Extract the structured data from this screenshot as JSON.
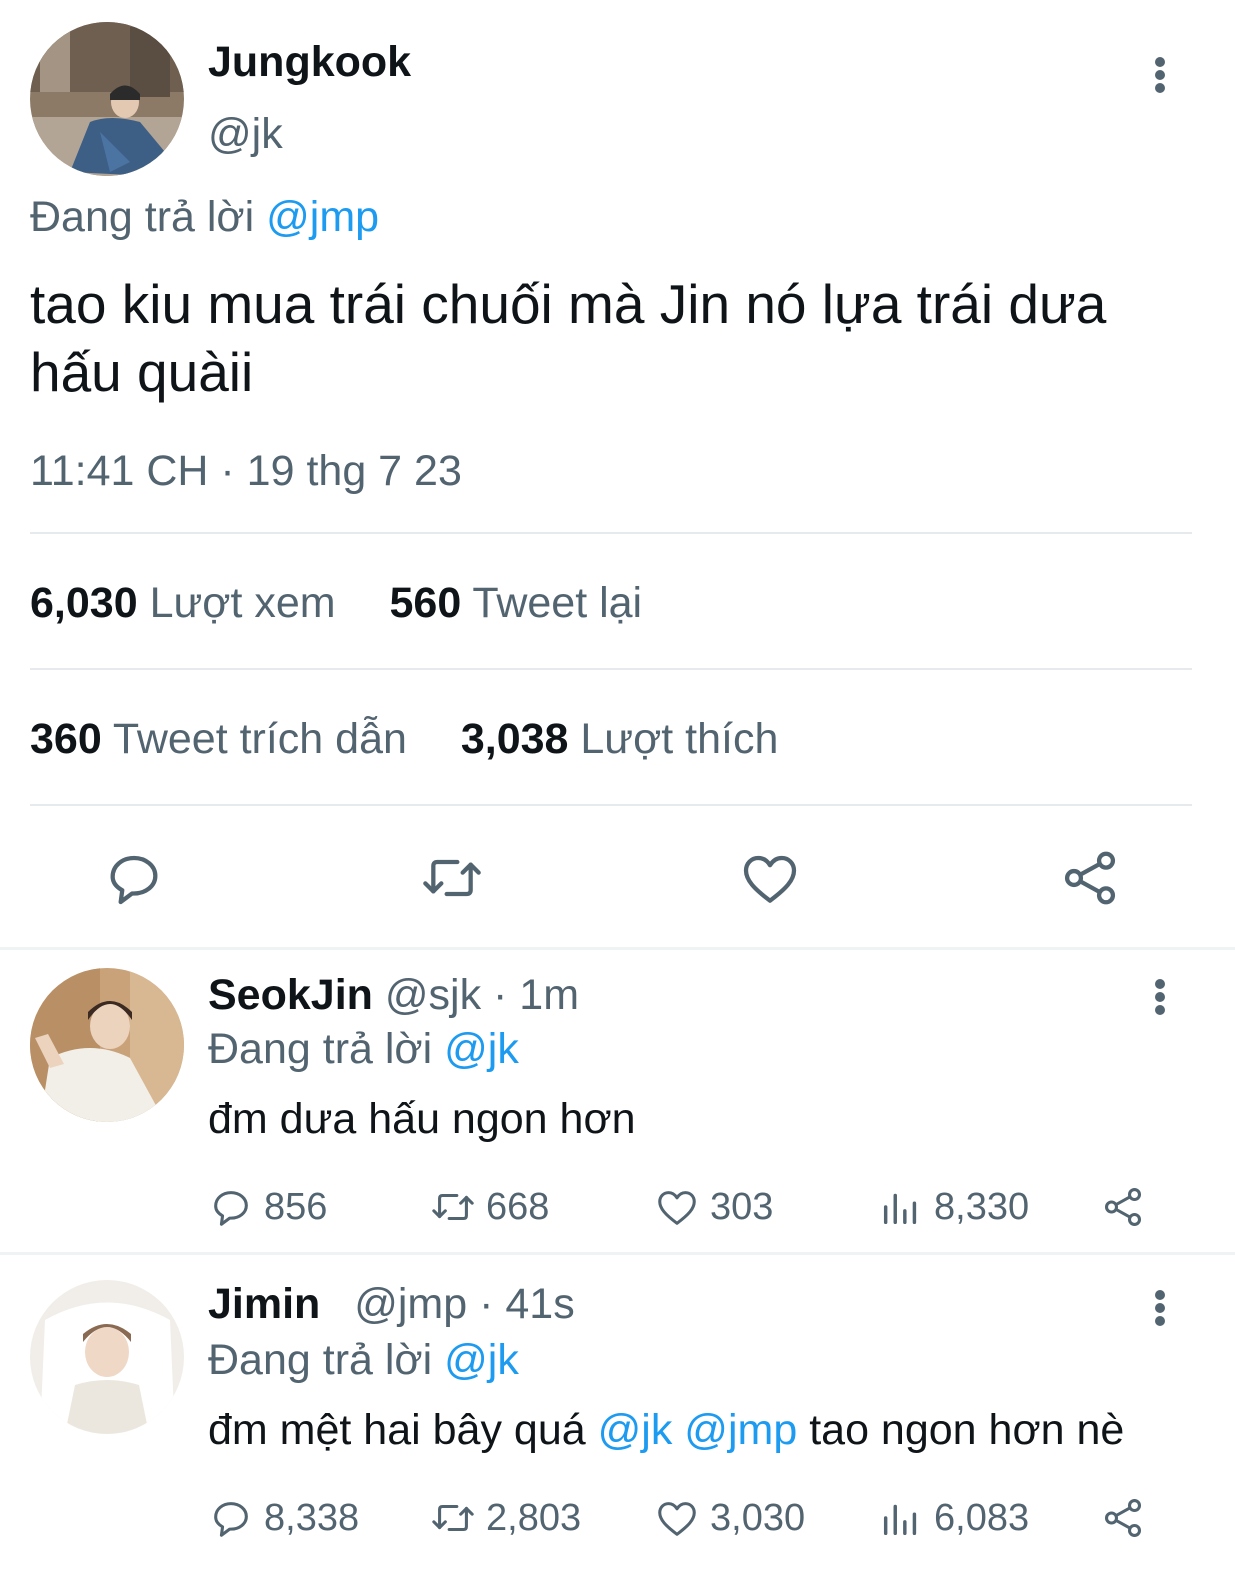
{
  "main_tweet": {
    "author_name": "Jungkook",
    "author_handle": "@jk",
    "replying_label": "Đang trả lời",
    "replying_to": "@jmp",
    "text": "tao kiu mua trái chuối mà Jin nó lựa trái dưa hấu quàii",
    "timestamp": "11:41 CH · 19 thg 7 23",
    "stats": {
      "views_count": "6,030",
      "views_label": "Lượt xem",
      "retweets_count": "560",
      "retweets_label": "Tweet lại",
      "quotes_count": "360",
      "quotes_label": "Tweet trích dẫn",
      "likes_count": "3,038",
      "likes_label": "Lượt thích"
    },
    "actions": [
      "reply-icon",
      "retweet-icon",
      "like-icon",
      "share-icon"
    ]
  },
  "replies": [
    {
      "author_name": "SeokJin",
      "author_handle": "@sjk",
      "time": "· 1m",
      "replying_label": "Đang trả lời",
      "replying_to": "@jk",
      "text": "đm dưa hấu ngon hơn",
      "reply_count": "856",
      "retweet_count": "668",
      "like_count": "303",
      "view_count": "8,330"
    },
    {
      "author_name": "Jimin",
      "author_handle": "@jmp",
      "time": "· 41s",
      "replying_label": "Đang trả lời",
      "replying_to": "@jk",
      "text_before": "đm mệt hai bây quá",
      "mention_1": "@jk",
      "mention_2": "@jmp",
      "text_after": "tao ngon hơn nè",
      "reply_count": "8,338",
      "retweet_count": "2,803",
      "like_count": "3,030",
      "view_count": "6,083"
    }
  ],
  "colors": {
    "text": "#0f1419",
    "secondary": "#536471",
    "link": "#1d9bf0",
    "divider": "#eff3f4"
  }
}
